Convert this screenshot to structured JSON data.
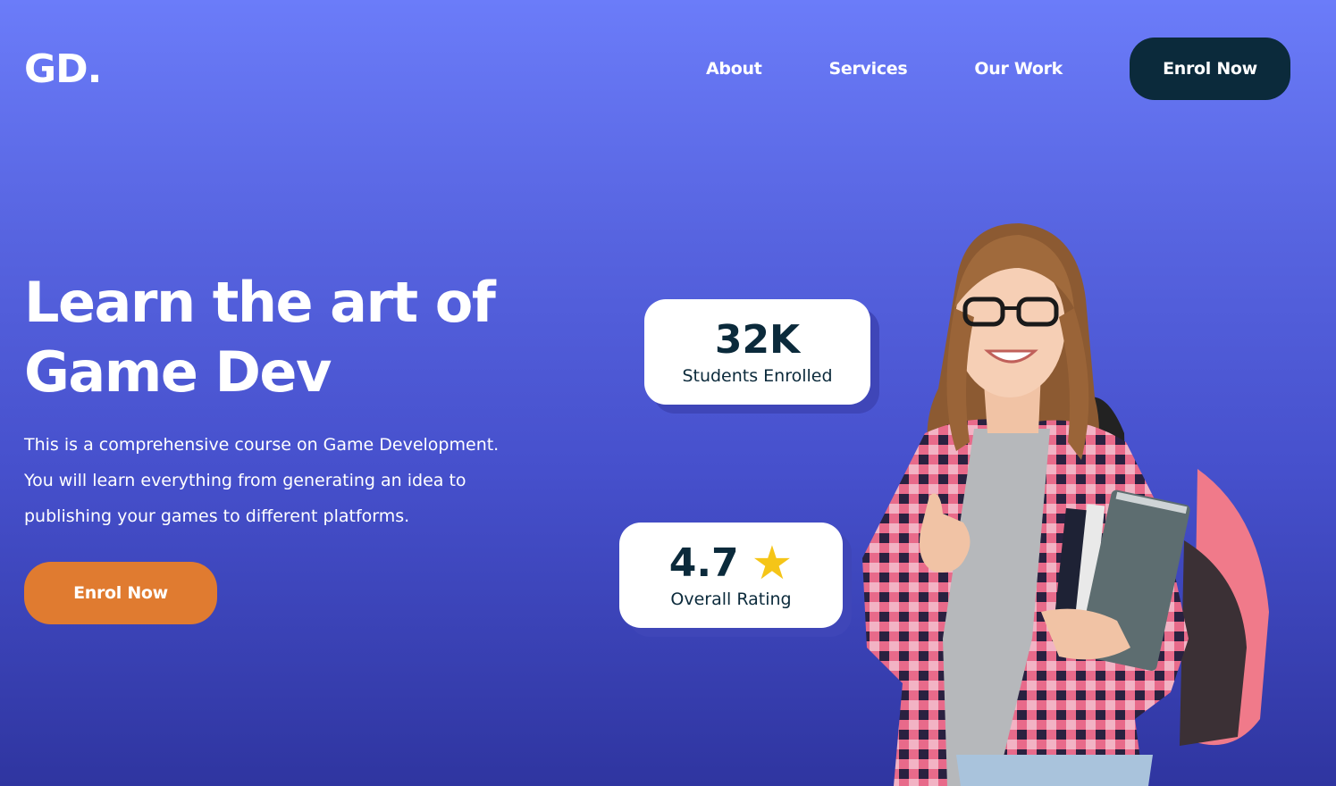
{
  "header": {
    "logo": "GD.",
    "nav": [
      "About",
      "Services",
      "Our Work"
    ],
    "cta_label": "Enrol Now"
  },
  "hero": {
    "title_line1": "Learn the art of",
    "title_line2": "Game Dev",
    "desc_line1": "This is a comprehensive course on Game Development.",
    "desc_line2": "You will learn everything from generating an idea to",
    "desc_line3": "publishing your games to different platforms.",
    "cta_label": "Enrol Now"
  },
  "stats": {
    "students_value": "32K",
    "students_label": "Students Enrolled",
    "rating_value": "4.7",
    "rating_icon": "star-icon",
    "rating_label": "Overall Rating"
  },
  "colors": {
    "accent": "#e07b30",
    "dark": "#0b2a3b",
    "star": "#f5c518",
    "bg_top": "#6b7cf9",
    "bg_bottom": "#2f35a0"
  }
}
